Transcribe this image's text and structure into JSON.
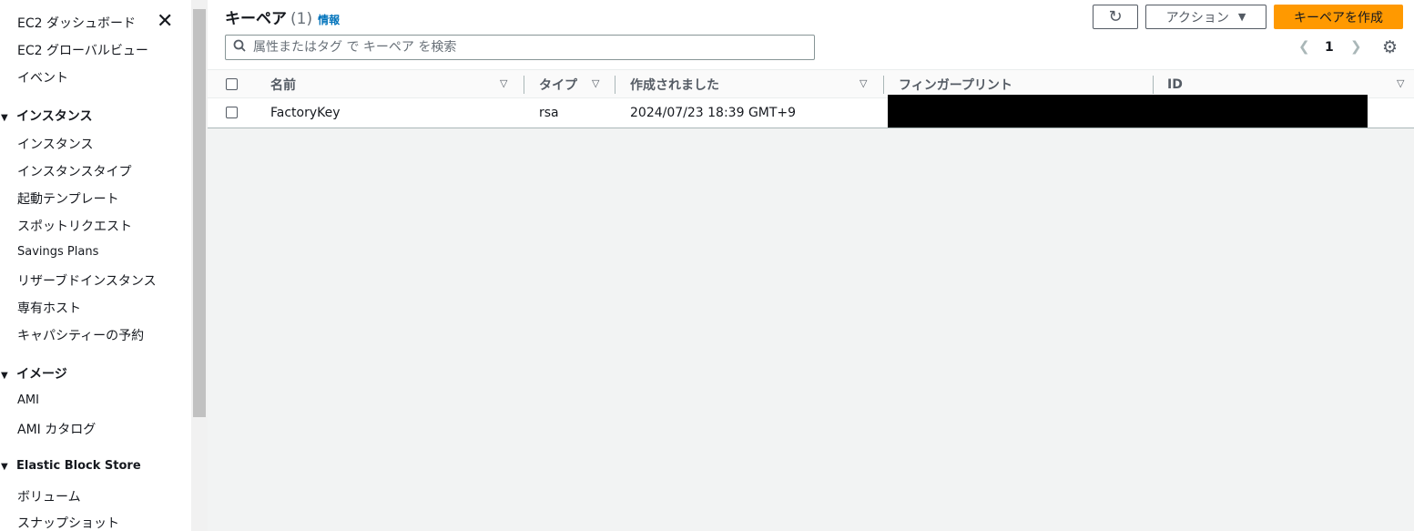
{
  "sidebar": {
    "top_items": [
      "EC2 ダッシュボード",
      "EC2 グローバルビュー",
      "イベント"
    ],
    "close_icon": "close-icon",
    "sections": [
      {
        "title": "インスタンス",
        "items": [
          "インスタンス",
          "インスタンスタイプ",
          "起動テンプレート",
          "スポットリクエスト",
          "Savings Plans",
          "リザーブドインスタンス",
          "専有ホスト",
          "キャパシティーの予約"
        ]
      },
      {
        "title": "イメージ",
        "items": [
          "AMI",
          "AMI カタログ"
        ]
      },
      {
        "title": "Elastic Block Store",
        "items": [
          "ボリューム",
          "スナップショット"
        ]
      }
    ]
  },
  "header": {
    "title": "キーペア",
    "count": "(1)",
    "info_link": "情報",
    "refresh_icon": "refresh-icon",
    "actions_label": "アクション",
    "create_label": "キーペアを作成",
    "accent_color": "#ff9900"
  },
  "search": {
    "placeholder": "属性またはタグ で キーペア を検索",
    "value": ""
  },
  "pagination": {
    "prev_icon": "chevron-left-icon",
    "page": "1",
    "next_icon": "chevron-right-icon",
    "settings_icon": "gear-icon"
  },
  "table": {
    "columns": [
      "名前",
      "タイプ",
      "作成されました",
      "フィンガープリント",
      "ID"
    ],
    "rows": [
      {
        "name": "FactoryKey",
        "type": "rsa",
        "created": "2024/07/23 18:39 GMT+9",
        "fingerprint": "",
        "id": ""
      }
    ]
  }
}
